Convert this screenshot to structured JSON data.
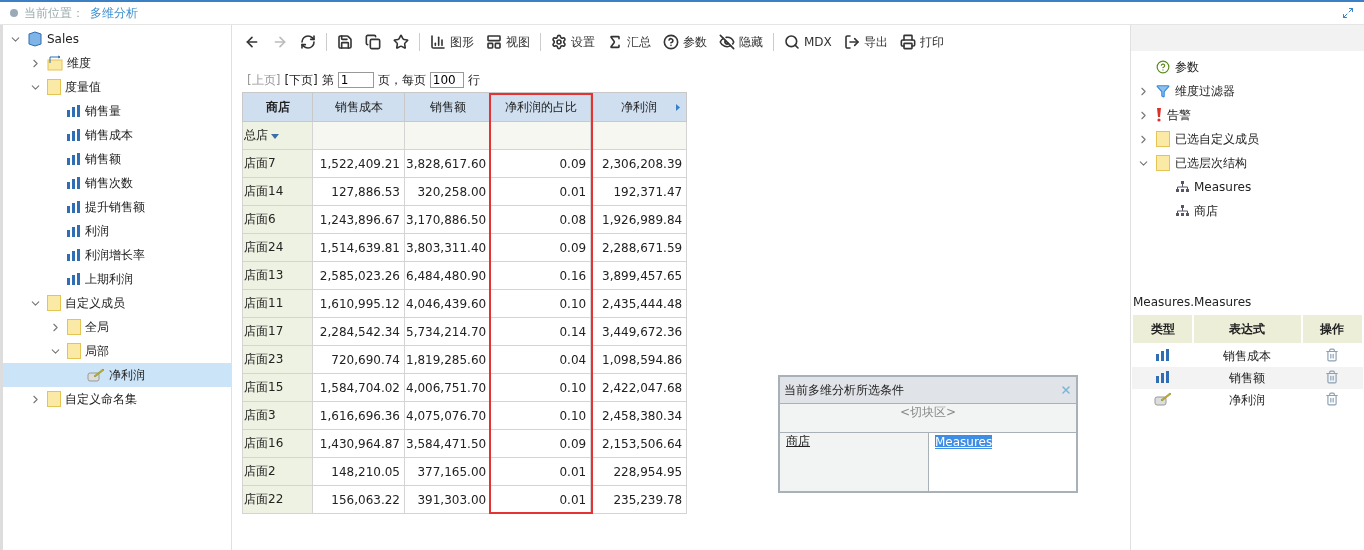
{
  "breadcrumb": {
    "label": "当前位置：",
    "current": "多维分析"
  },
  "tree": [
    {
      "label": "Sales",
      "kind": "cube",
      "expanded": true,
      "selected": false,
      "children": [
        {
          "label": "维度",
          "kind": "dimension",
          "expanded": false,
          "selected": false
        },
        {
          "label": "度量值",
          "kind": "folder",
          "expanded": true,
          "selected": false,
          "children": [
            {
              "label": "销售量",
              "kind": "measure",
              "selected": false
            },
            {
              "label": "销售成本",
              "kind": "measure",
              "selected": false
            },
            {
              "label": "销售额",
              "kind": "measure",
              "selected": false
            },
            {
              "label": "销售次数",
              "kind": "measure",
              "selected": false
            },
            {
              "label": "提升销售额",
              "kind": "measure",
              "selected": false
            },
            {
              "label": "利润",
              "kind": "measure",
              "selected": false
            },
            {
              "label": "利润增长率",
              "kind": "measure",
              "selected": false
            },
            {
              "label": "上期利润",
              "kind": "measure",
              "selected": false
            }
          ]
        },
        {
          "label": "自定义成员",
          "kind": "folder",
          "expanded": true,
          "selected": false,
          "children": [
            {
              "label": "全局",
              "kind": "folder",
              "expanded": false,
              "selected": false
            },
            {
              "label": "局部",
              "kind": "folder",
              "expanded": true,
              "selected": false,
              "children": [
                {
                  "label": "净利润",
                  "kind": "calc",
                  "selected": true
                }
              ]
            }
          ]
        },
        {
          "label": "自定义命名集",
          "kind": "folder",
          "expanded": false,
          "selected": false
        }
      ]
    }
  ],
  "toolbar": [
    {
      "kind": "back",
      "disabled": false
    },
    {
      "kind": "forward",
      "disabled": true
    },
    {
      "kind": "refresh",
      "disabled": false
    },
    {
      "kind": "sep"
    },
    {
      "kind": "save",
      "disabled": false
    },
    {
      "kind": "saveas",
      "disabled": false
    },
    {
      "kind": "star",
      "disabled": false
    },
    {
      "kind": "sep"
    },
    {
      "kind": "chart",
      "label": "图形",
      "disabled": false
    },
    {
      "kind": "view",
      "label": "视图",
      "disabled": false
    },
    {
      "kind": "sep"
    },
    {
      "kind": "settings",
      "label": "设置",
      "disabled": false
    },
    {
      "kind": "sum",
      "label": "汇总",
      "disabled": false
    },
    {
      "kind": "help",
      "label": "参数",
      "disabled": false
    },
    {
      "kind": "hide",
      "label": "隐藏",
      "disabled": false
    },
    {
      "kind": "sep"
    },
    {
      "kind": "search",
      "label": "MDX",
      "disabled": false
    },
    {
      "kind": "export",
      "label": "导出",
      "disabled": false
    },
    {
      "kind": "print",
      "label": "打印",
      "disabled": false
    }
  ],
  "pager": {
    "prev": {
      "label": "[上页]",
      "disabled": true
    },
    "next": {
      "label": "[下页]",
      "disabled": false
    },
    "page_label": "第",
    "page": "1",
    "per_page_label": "页，每页",
    "per_page": "100",
    "rows_label": "行"
  },
  "table": {
    "columns": [
      {
        "label": "商店",
        "highlighted": false
      },
      {
        "label": "销售成本",
        "highlighted": false
      },
      {
        "label": "销售额",
        "highlighted": false
      },
      {
        "label": "净利润的占比",
        "highlighted": true
      },
      {
        "label": "净利润",
        "highlighted": false
      }
    ],
    "level_member": "总店",
    "rows": [
      [
        "店面7",
        "1,522,409.21",
        "3,828,617.60",
        "0.09",
        "2,306,208.39"
      ],
      [
        "店面14",
        "127,886.53",
        "320,258.00",
        "0.01",
        "192,371.47"
      ],
      [
        "店面6",
        "1,243,896.67",
        "3,170,886.50",
        "0.08",
        "1,926,989.84"
      ],
      [
        "店面24",
        "1,514,639.81",
        "3,803,311.40",
        "0.09",
        "2,288,671.59"
      ],
      [
        "店面13",
        "2,585,023.26",
        "6,484,480.90",
        "0.16",
        "3,899,457.65"
      ],
      [
        "店面11",
        "1,610,995.12",
        "4,046,439.60",
        "0.10",
        "2,435,444.48"
      ],
      [
        "店面17",
        "2,284,542.34",
        "5,734,214.70",
        "0.14",
        "3,449,672.36"
      ],
      [
        "店面23",
        "720,690.74",
        "1,819,285.60",
        "0.04",
        "1,098,594.86"
      ],
      [
        "店面15",
        "1,584,704.02",
        "4,006,751.70",
        "0.10",
        "2,422,047.68"
      ],
      [
        "店面3",
        "1,616,696.36",
        "4,075,076.70",
        "0.10",
        "2,458,380.34"
      ],
      [
        "店面16",
        "1,430,964.87",
        "3,584,471.50",
        "0.09",
        "2,153,506.64"
      ],
      [
        "店面2",
        "148,210.05",
        "377,165.00",
        "0.01",
        "228,954.95"
      ],
      [
        "店面22",
        "156,063.22",
        "391,303.00",
        "0.01",
        "235,239.78"
      ]
    ]
  },
  "conditions": {
    "title": "当前多维分析所选条件",
    "slice_label": "<切块区>",
    "row_axis": "商店",
    "column_axis": "Measures"
  },
  "right_tree": [
    {
      "label": "参数",
      "kind": "param"
    },
    {
      "label": "维度过滤器",
      "kind": "filter",
      "expanded": false
    },
    {
      "label": "告警",
      "kind": "alert",
      "expanded": false
    },
    {
      "label": "已选自定义成员",
      "kind": "folder",
      "expanded": false
    },
    {
      "label": "已选层次结构",
      "kind": "folder",
      "expanded": true,
      "children": [
        {
          "label": "Measures",
          "kind": "hierarchy"
        },
        {
          "label": "商店",
          "kind": "hierarchy"
        }
      ]
    }
  ],
  "measures": {
    "title": "Measures.Measures",
    "columns": [
      "类型",
      "表达式",
      "操作"
    ],
    "rows": [
      {
        "kind": "measure",
        "expression": "销售成本"
      },
      {
        "kind": "measure",
        "expression": "销售额"
      },
      {
        "kind": "calc",
        "expression": "净利润"
      }
    ]
  }
}
